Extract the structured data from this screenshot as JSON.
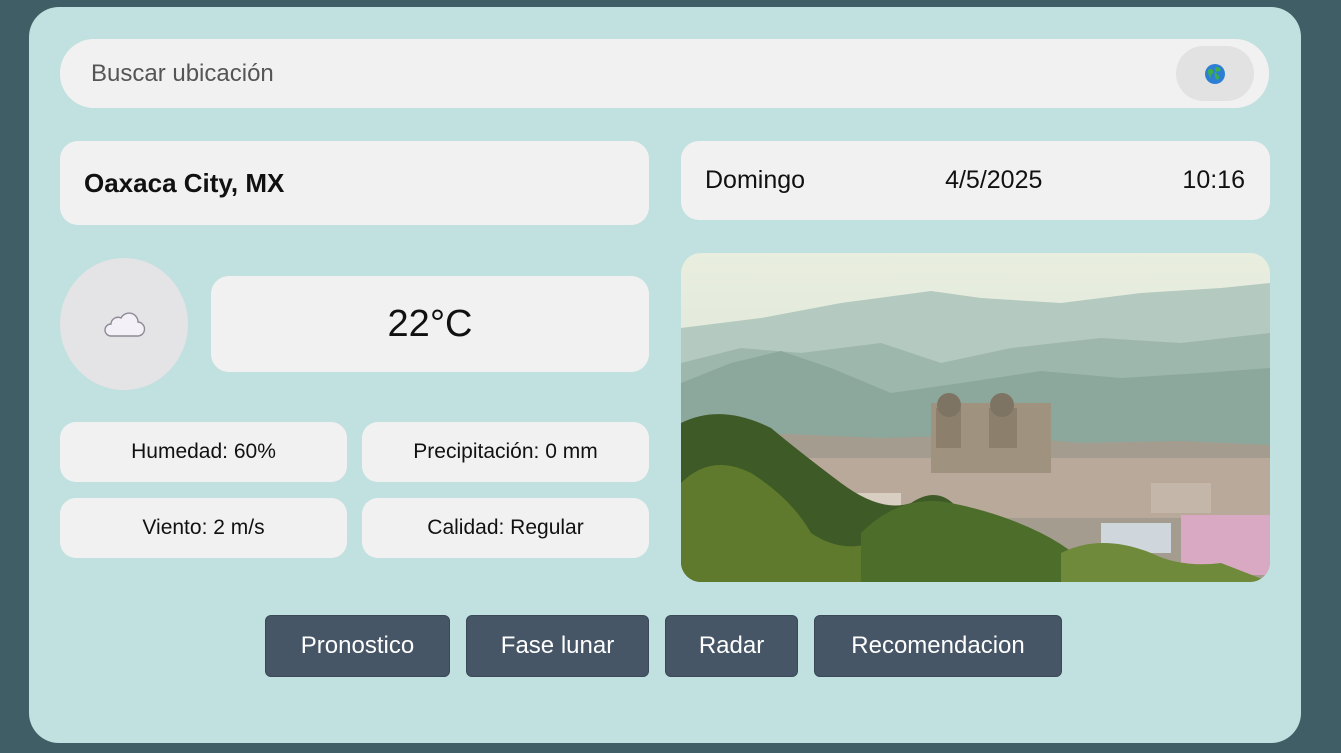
{
  "search": {
    "placeholder": "Buscar ubicación",
    "button_icon": "globe-icon"
  },
  "location": {
    "name": "Oaxaca City, MX"
  },
  "datetime": {
    "day": "Domingo",
    "date": "4/5/2025",
    "time": "10:16"
  },
  "weather": {
    "icon": "cloud-icon",
    "temperature": "22°C",
    "humidity": "Humedad: 60%",
    "precipitation": "Precipitación: 0 mm",
    "wind": "Viento: 2 m/s",
    "quality": "Calidad: Regular"
  },
  "actions": [
    {
      "label": "Pronostico"
    },
    {
      "label": "Fase lunar"
    },
    {
      "label": "Radar"
    },
    {
      "label": "Recomendacion"
    }
  ],
  "colors": {
    "background": "#3f5e66",
    "card": "#c0e1df",
    "pill": "#f2f1f1",
    "button": "#465667"
  }
}
